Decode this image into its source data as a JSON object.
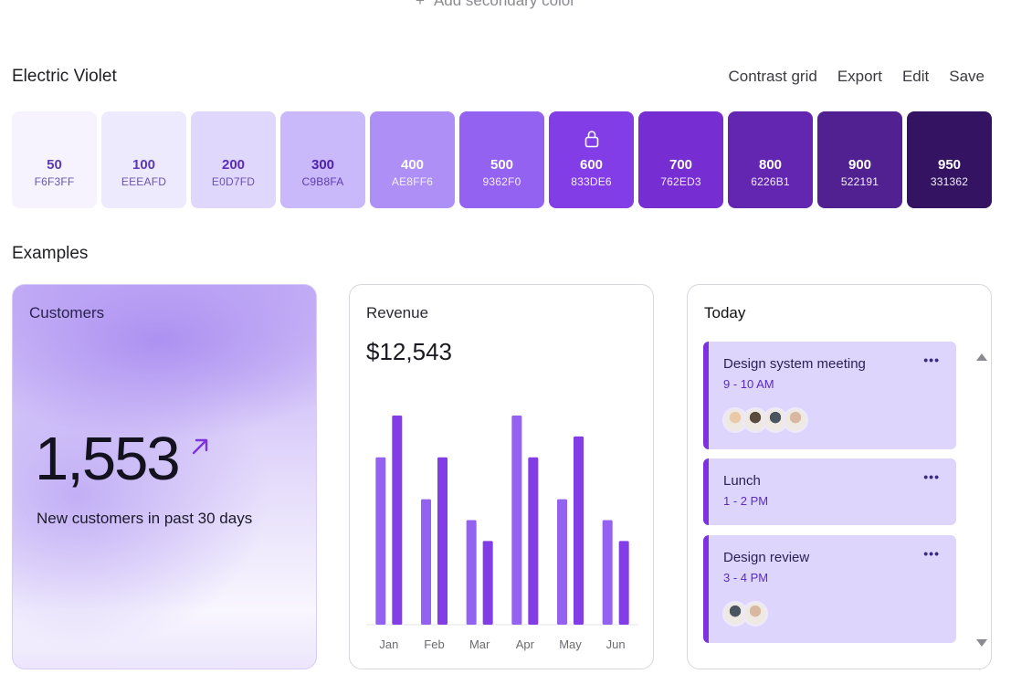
{
  "top_link": {
    "plus": "+",
    "label": "Add secondary color"
  },
  "palette": {
    "title": "Electric Violet",
    "actions": [
      "Contrast grid",
      "Export",
      "Edit",
      "Save"
    ],
    "swatches": [
      {
        "shade": "50",
        "hex": "F6F3FF",
        "bg": "#F6F3FF",
        "fg": "#5a3bb0",
        "fg2": "#6a55a8"
      },
      {
        "shade": "100",
        "hex": "EEEAFD",
        "bg": "#EEEAFD",
        "fg": "#5a3bb0",
        "fg2": "#6a55a8"
      },
      {
        "shade": "200",
        "hex": "E0D7FD",
        "bg": "#E0D7FD",
        "fg": "#5a2dbb",
        "fg2": "#6a50b5"
      },
      {
        "shade": "300",
        "hex": "C9B8FA",
        "bg": "#C9B8FA",
        "fg": "#4f22a8",
        "fg2": "#5e3bb0"
      },
      {
        "shade": "400",
        "hex": "AE8FF6",
        "bg": "#AE8FF6",
        "fg": "#ffffff",
        "fg2": "#f3eefe"
      },
      {
        "shade": "500",
        "hex": "9362F0",
        "bg": "#9362F0",
        "fg": "#ffffff",
        "fg2": "#f3eefe"
      },
      {
        "shade": "600",
        "hex": "833DE6",
        "bg": "#833DE6",
        "fg": "#ffffff",
        "fg2": "#f3eefe",
        "locked": true
      },
      {
        "shade": "700",
        "hex": "762ED3",
        "bg": "#762ED3",
        "fg": "#ffffff",
        "fg2": "#f3eefe"
      },
      {
        "shade": "800",
        "hex": "6226B1",
        "bg": "#6226B1",
        "fg": "#ffffff",
        "fg2": "#f3eefe"
      },
      {
        "shade": "900",
        "hex": "522191",
        "bg": "#522191",
        "fg": "#ffffff",
        "fg2": "#f3eefe"
      },
      {
        "shade": "950",
        "hex": "331362",
        "bg": "#331362",
        "fg": "#ffffff",
        "fg2": "#f3eefe"
      }
    ]
  },
  "examples": {
    "title": "Examples",
    "customers": {
      "label": "Customers",
      "value": "1,553",
      "subtitle": "New customers in past 30 days"
    },
    "revenue": {
      "label": "Revenue",
      "value": "$12,543"
    },
    "today": {
      "label": "Today",
      "events": [
        {
          "title": "Design system meeting",
          "time": "9 - 10 AM",
          "more": "•••",
          "avatars": [
            "#e9c9a8",
            "#5b4a3e",
            "#4a5560",
            "#d8b8a0"
          ]
        },
        {
          "title": "Lunch",
          "time": "1 - 2 PM",
          "more": "•••",
          "avatars": []
        },
        {
          "title": "Design review",
          "time": "3 - 4 PM",
          "more": "•••",
          "avatars": [
            "#4a5560",
            "#d8b8a0"
          ]
        }
      ]
    }
  },
  "chart_data": {
    "type": "bar",
    "categories": [
      "Jan",
      "Feb",
      "Mar",
      "Apr",
      "May",
      "Jun"
    ],
    "series": [
      {
        "values": [
          8,
          6,
          5,
          10,
          6,
          5
        ],
        "color": "#9362F0"
      },
      {
        "values": [
          10,
          8,
          4,
          8,
          9,
          4
        ],
        "color": "#833DE6"
      }
    ],
    "ylim": [
      0,
      10
    ],
    "grid": false,
    "legend": "none"
  }
}
